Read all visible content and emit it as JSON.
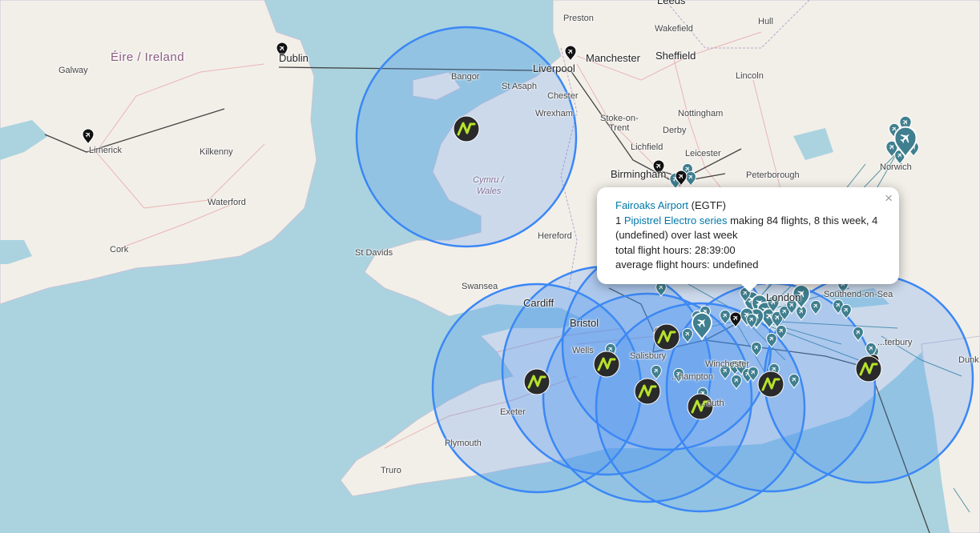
{
  "places": [
    {
      "id": "leeds",
      "label": "Leeds",
      "kind": "city"
    },
    {
      "id": "preston",
      "label": "Preston",
      "kind": "town"
    },
    {
      "id": "wakefield",
      "label": "Wakefield",
      "kind": "town"
    },
    {
      "id": "hull",
      "label": "Hull",
      "kind": "town"
    },
    {
      "id": "manchester",
      "label": "Manchester",
      "kind": "city"
    },
    {
      "id": "sheffield",
      "label": "Sheffield",
      "kind": "city"
    },
    {
      "id": "liverpool",
      "label": "Liverpool",
      "kind": "city"
    },
    {
      "id": "dublin",
      "label": "Dublin",
      "kind": "city"
    },
    {
      "id": "eire",
      "label": "Éire / Ireland",
      "kind": "country"
    },
    {
      "id": "galway",
      "label": "Galway",
      "kind": "town"
    },
    {
      "id": "bangor",
      "label": "Bangor",
      "kind": "town"
    },
    {
      "id": "stasaph",
      "label": "St Asaph",
      "kind": "town"
    },
    {
      "id": "chester",
      "label": "Chester",
      "kind": "town"
    },
    {
      "id": "wrexham",
      "label": "Wrexham",
      "kind": "town"
    },
    {
      "id": "stoke",
      "label": "Stoke-on-",
      "kind": "town"
    },
    {
      "id": "trent",
      "label": "Trent",
      "kind": "town"
    },
    {
      "id": "nottingham",
      "label": "Nottingham",
      "kind": "town"
    },
    {
      "id": "lincoln",
      "label": "Lincoln",
      "kind": "town"
    },
    {
      "id": "derby",
      "label": "Derby",
      "kind": "town"
    },
    {
      "id": "lichfield",
      "label": "Lichfield",
      "kind": "town"
    },
    {
      "id": "leicester",
      "label": "Leicester",
      "kind": "town"
    },
    {
      "id": "birmingham",
      "label": "Birmingham",
      "kind": "city"
    },
    {
      "id": "peterborough",
      "label": "Peterborough",
      "kind": "town"
    },
    {
      "id": "norwich",
      "label": "Norwich",
      "kind": "town"
    },
    {
      "id": "limerick",
      "label": "Limerick",
      "kind": "town"
    },
    {
      "id": "kilkenny",
      "label": "Kilkenny",
      "kind": "town"
    },
    {
      "id": "waterford",
      "label": "Waterford",
      "kind": "town"
    },
    {
      "id": "cork",
      "label": "Cork",
      "kind": "town"
    },
    {
      "id": "cymru",
      "label": "Cymru /",
      "kind": "region"
    },
    {
      "id": "wales",
      "label": "Wales",
      "kind": "region"
    },
    {
      "id": "hereford",
      "label": "Hereford",
      "kind": "town"
    },
    {
      "id": "stdavids",
      "label": "St Davids",
      "kind": "town"
    },
    {
      "id": "swansea",
      "label": "Swansea",
      "kind": "town"
    },
    {
      "id": "cardiff",
      "label": "Cardiff",
      "kind": "city"
    },
    {
      "id": "bristol",
      "label": "Bristol",
      "kind": "city"
    },
    {
      "id": "wells",
      "label": "Wells",
      "kind": "town"
    },
    {
      "id": "salisbury",
      "label": "Salisbury",
      "kind": "town"
    },
    {
      "id": "winchester",
      "label": "Winchester",
      "kind": "town"
    },
    {
      "id": "southampton",
      "label": "...hampton",
      "kind": "town"
    },
    {
      "id": "portsmouth",
      "label": "...outh",
      "kind": "town"
    },
    {
      "id": "exeter",
      "label": "Exeter",
      "kind": "town"
    },
    {
      "id": "plymouth",
      "label": "Plymouth",
      "kind": "town"
    },
    {
      "id": "truro",
      "label": "Truro",
      "kind": "town"
    },
    {
      "id": "london",
      "label": "London",
      "kind": "city"
    },
    {
      "id": "southend",
      "label": "Southend-on-Sea",
      "kind": "town"
    },
    {
      "id": "canterbury",
      "label": "...terbury",
      "kind": "town"
    },
    {
      "id": "dunk",
      "label": "Dunk",
      "kind": "town"
    }
  ],
  "colors": {
    "sea": "#aad3df",
    "land": "#f2efe9",
    "circle_fill": "#3f8cf0",
    "circle_stroke": "#3b87f5",
    "pin": "#3f7f8f",
    "logo_bg": "#2a2a2a",
    "logo_mark": "#b6e32a",
    "black_pin": "#111111"
  },
  "marker_logo": "AV",
  "popup": {
    "airport_link": "Fairoaks Airport",
    "code": "(EGTF)",
    "line1_prefix": "1",
    "aircraft_link": "Pipistrel Electro series",
    "line1_suffix": "making 84 flights, 8 this week, 4 (undefined) over last week",
    "line2": "total flight hours: 28:39:00",
    "line3": "average flight hours: undefined",
    "close": "×"
  },
  "icons": {
    "close": "close-icon",
    "airport_pin": "plane-pin-icon",
    "black_pin": "airport-pin-icon",
    "av_marker": "av-logo-icon"
  }
}
